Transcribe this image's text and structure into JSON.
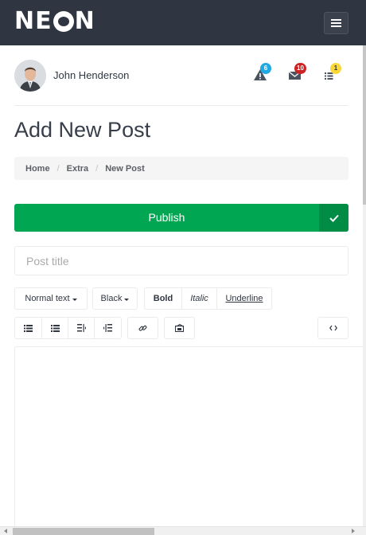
{
  "app": {
    "logo_text_left": "NE",
    "logo_text_right": "N"
  },
  "topbar": {
    "menu_icon": "hamburger-icon"
  },
  "user": {
    "name": "John Henderson"
  },
  "notifications": [
    {
      "icon": "warning-icon",
      "count": "6",
      "color": "#21a9e1"
    },
    {
      "icon": "envelope-icon",
      "count": "10",
      "color": "#cc2424"
    },
    {
      "icon": "list-icon",
      "count": "1",
      "color": "#fad839"
    }
  ],
  "page": {
    "title": "Add New Post"
  },
  "breadcrumb": [
    "Home",
    "Extra",
    "New Post"
  ],
  "publish": {
    "label": "Publish",
    "icon": "checkmark-icon",
    "color": "#00a651"
  },
  "post": {
    "title_placeholder": "Post title",
    "title_value": ""
  },
  "toolbar": {
    "text_style": "Normal text",
    "text_color": "Black",
    "bold": "Bold",
    "italic": "Italic",
    "underline": "Underline",
    "icons": [
      "unordered-list-icon",
      "ordered-list-icon",
      "outdent-icon",
      "indent-icon",
      "link-icon",
      "image-icon",
      "html-code-icon"
    ]
  }
}
